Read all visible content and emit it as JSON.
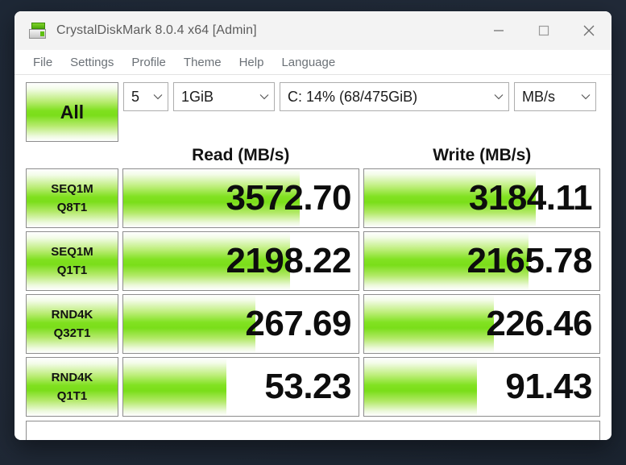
{
  "window": {
    "title": "CrystalDiskMark 8.0.4 x64 [Admin]",
    "icon": "disk-benchmark-icon",
    "controls": {
      "minimize": "minimize-icon",
      "maximize": "maximize-icon",
      "close": "close-icon"
    }
  },
  "menubar": {
    "items": [
      {
        "label": "File"
      },
      {
        "label": "Settings"
      },
      {
        "label": "Profile"
      },
      {
        "label": "Theme"
      },
      {
        "label": "Help"
      },
      {
        "label": "Language"
      }
    ]
  },
  "toolbar": {
    "all_button_label": "All",
    "combos": [
      {
        "name": "test-count",
        "value": "5"
      },
      {
        "name": "test-size",
        "value": "1GiB"
      },
      {
        "name": "target-drive",
        "value": "C: 14% (68/475GiB)"
      },
      {
        "name": "unit",
        "value": "MB/s"
      }
    ],
    "chevron_icon": "chevron-down-icon"
  },
  "columns": {
    "read_header": "Read (MB/s)",
    "write_header": "Write (MB/s)"
  },
  "statusbar": {
    "text": ""
  },
  "colors": {
    "accent_green": "#7fe01e",
    "window_chrome": "#f3f3f3",
    "desktop": "#1e2836",
    "text": "#0d0d0d",
    "menu_text": "#6b7177"
  },
  "chart_data": {
    "type": "bar",
    "title": "CrystalDiskMark 8.0.4 x64 [Admin]",
    "xlabel": "",
    "ylabel": "",
    "unit": "MB/s",
    "test_count": "5",
    "test_size": "1GiB",
    "target": "C: 14% (68/475GiB)",
    "categories": [
      "SEQ1M Q8T1",
      "SEQ1M Q1T1",
      "RND4K Q32T1",
      "RND4K Q1T1"
    ],
    "series": [
      {
        "name": "Read (MB/s)",
        "values": [
          3572.7,
          2198.22,
          267.69,
          53.23
        ]
      },
      {
        "name": "Write (MB/s)",
        "values": [
          3184.11,
          2165.78,
          226.46,
          91.43
        ]
      }
    ],
    "rows": [
      {
        "label_line1": "SEQ1M",
        "label_line2": "Q8T1",
        "read": {
          "value": "3572.70",
          "fill_pct": 75
        },
        "write": {
          "value": "3184.11",
          "fill_pct": 73
        }
      },
      {
        "label_line1": "SEQ1M",
        "label_line2": "Q1T1",
        "read": {
          "value": "2198.22",
          "fill_pct": 71
        },
        "write": {
          "value": "2165.78",
          "fill_pct": 70
        }
      },
      {
        "label_line1": "RND4K",
        "label_line2": "Q32T1",
        "read": {
          "value": "267.69",
          "fill_pct": 56
        },
        "write": {
          "value": "226.46",
          "fill_pct": 55
        }
      },
      {
        "label_line1": "RND4K",
        "label_line2": "Q1T1",
        "read": {
          "value": "53.23",
          "fill_pct": 44
        },
        "write": {
          "value": "91.43",
          "fill_pct": 48
        }
      }
    ],
    "legend_position": "top",
    "grid": false
  }
}
